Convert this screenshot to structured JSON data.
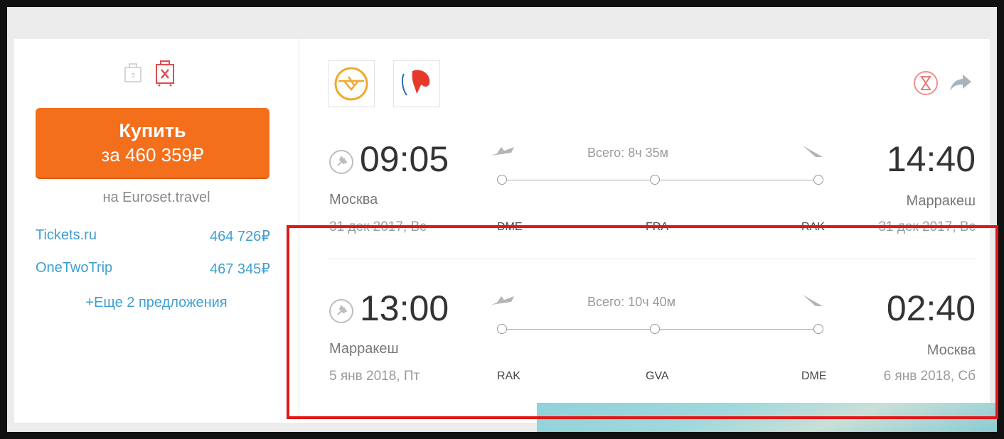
{
  "buy": {
    "label": "Купить",
    "price_line": "за 460 359₽"
  },
  "agency": "на Euroset.travel",
  "offers": [
    {
      "name": "Tickets.ru",
      "price": "464 726₽"
    },
    {
      "name": "OneTwoTrip",
      "price": "467 345₽"
    }
  ],
  "more_offers": "+Еще 2 предложения",
  "outbound": {
    "depart_time": "09:05",
    "depart_city": "Москва",
    "depart_date": "31 дек 2017, Вс",
    "total": "Всего: 8ч 35м",
    "arrive_time": "14:40",
    "arrive_city": "Марракеш",
    "arrive_date": "31 дек 2017, Вс",
    "codes": [
      "DME",
      "FRA",
      "RAK"
    ]
  },
  "inbound": {
    "depart_time": "13:00",
    "depart_city": "Марракеш",
    "depart_date": "5 янв 2018, Пт",
    "total": "Всего: 10ч 40м",
    "arrive_time": "02:40",
    "arrive_city": "Москва",
    "arrive_date": "6 янв 2018, Сб",
    "codes": [
      "RAK",
      "GVA",
      "DME"
    ]
  },
  "colors": {
    "accent_orange": "#f36f1c",
    "link_blue": "#3f9fd1",
    "highlight_red": "#e21818"
  },
  "icons": [
    "baggage-icon",
    "no-luggage-icon",
    "lufthansa-logo",
    "airline-logo",
    "hourglass-icon",
    "share-icon",
    "pin-icon",
    "takeoff-icon",
    "landing-icon"
  ]
}
